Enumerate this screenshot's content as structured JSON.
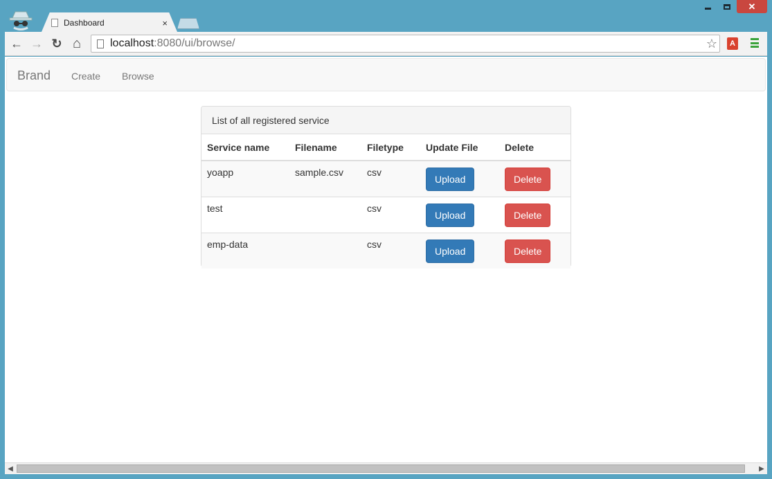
{
  "browser": {
    "tab_title": "Dashboard",
    "tab_close": "×",
    "url_host": "localhost",
    "url_rest": ":8080/ui/browse/",
    "back_icon": "←",
    "forward_icon": "→",
    "reload_icon": "↻",
    "home_icon": "⌂",
    "star_icon": "☆",
    "ext_label": "A",
    "close_icon": "✕"
  },
  "navbar": {
    "brand": "Brand",
    "links": [
      "Create",
      "Browse"
    ]
  },
  "panel": {
    "heading": "List of all registered service",
    "columns": [
      "Service name",
      "Filename",
      "Filetype",
      "Update File",
      "Delete"
    ],
    "rows": [
      {
        "service": "yoapp",
        "filename": "sample.csv",
        "filetype": "csv",
        "upload_label": "Upload",
        "delete_label": "Delete"
      },
      {
        "service": "test",
        "filename": "",
        "filetype": "csv",
        "upload_label": "Upload",
        "delete_label": "Delete"
      },
      {
        "service": "emp-data",
        "filename": "",
        "filetype": "csv",
        "upload_label": "Upload",
        "delete_label": "Delete"
      }
    ]
  },
  "colors": {
    "primary": "#337ab7",
    "danger": "#d9534f",
    "window_frame": "#58a4c2"
  }
}
